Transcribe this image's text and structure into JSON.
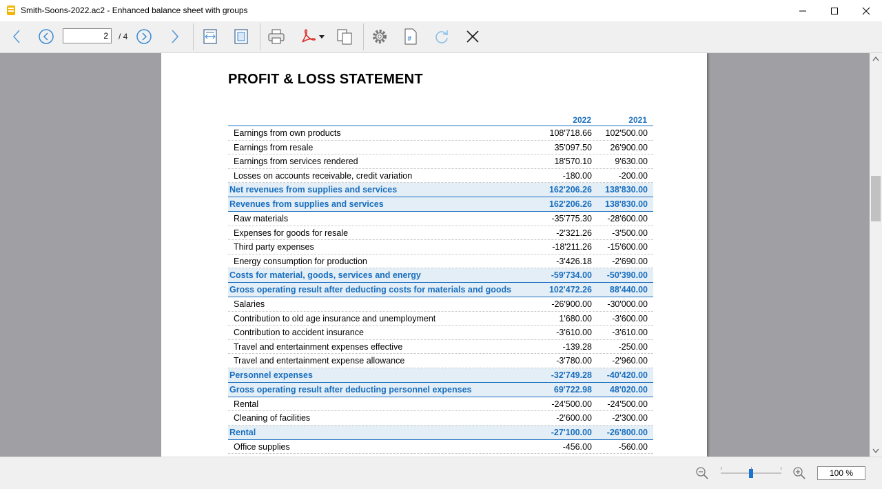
{
  "window": {
    "title": "Smith-Soons-2022.ac2 - Enhanced balance sheet with groups"
  },
  "toolbar": {
    "current_page": "2",
    "total_pages": "/ 4",
    "buttons": [
      "back-arrow-icon",
      "previous-page-icon",
      "next-page-icon",
      "forward-arrow-icon",
      "fit-width-icon",
      "fit-page-icon",
      "print-icon",
      "pdf-icon",
      "copy-icon",
      "settings-icon",
      "page-number-icon",
      "refresh-icon",
      "close-icon"
    ]
  },
  "report": {
    "title": "PROFIT & LOSS STATEMENT",
    "col1": "2022",
    "col2": "2021",
    "rows": [
      {
        "label": "Earnings from own products",
        "v1": "108'718.66",
        "v2": "102'500.00",
        "group": false
      },
      {
        "label": "Earnings from resale",
        "v1": "35'097.50",
        "v2": "26'900.00",
        "group": false
      },
      {
        "label": "Earnings from services rendered",
        "v1": "18'570.10",
        "v2": "9'630.00",
        "group": false
      },
      {
        "label": "Losses on accounts receivable, credit variation",
        "v1": "-180.00",
        "v2": "-200.00",
        "group": false
      },
      {
        "label": "Net revenues from supplies and services",
        "v1": "162'206.26",
        "v2": "138'830.00",
        "group": true
      },
      {
        "label": "Revenues from supplies and services",
        "v1": "162'206.26",
        "v2": "138'830.00",
        "group": true
      },
      {
        "label": "Raw materials",
        "v1": "-35'775.30",
        "v2": "-28'600.00",
        "group": false
      },
      {
        "label": "Expenses for goods for resale",
        "v1": "-2'321.26",
        "v2": "-3'500.00",
        "group": false
      },
      {
        "label": "Third party expenses",
        "v1": "-18'211.26",
        "v2": "-15'600.00",
        "group": false
      },
      {
        "label": "Energy consumption for production",
        "v1": "-3'426.18",
        "v2": "-2'690.00",
        "group": false
      },
      {
        "label": "Costs for material, goods, services and energy",
        "v1": "-59'734.00",
        "v2": "-50'390.00",
        "group": true
      },
      {
        "label": "Gross operating result after deducting costs for materials and goods",
        "v1": "102'472.26",
        "v2": "88'440.00",
        "group": true
      },
      {
        "label": "Salaries",
        "v1": "-26'900.00",
        "v2": "-30'000.00",
        "group": false
      },
      {
        "label": "Contribution to old age insurance and unemployment",
        "v1": "1'680.00",
        "v2": "-3'600.00",
        "group": false
      },
      {
        "label": "Contribution to accident insurance",
        "v1": "-3'610.00",
        "v2": "-3'610.00",
        "group": false
      },
      {
        "label": "Travel and entertainment expenses effective",
        "v1": "-139.28",
        "v2": "-250.00",
        "group": false
      },
      {
        "label": "Travel and entertainment expense allowance",
        "v1": "-3'780.00",
        "v2": "-2'960.00",
        "group": false
      },
      {
        "label": "Personnel expenses",
        "v1": "-32'749.28",
        "v2": "-40'420.00",
        "group": true
      },
      {
        "label": "Gross operating result after deducting personnel expenses",
        "v1": "69'722.98",
        "v2": "48'020.00",
        "group": true
      },
      {
        "label": "Rental",
        "v1": "-24'500.00",
        "v2": "-24'500.00",
        "group": false
      },
      {
        "label": "Cleaning of facilities",
        "v1": "-2'600.00",
        "v2": "-2'300.00",
        "group": false
      },
      {
        "label": "Rental",
        "v1": "-27'100.00",
        "v2": "-26'800.00",
        "group": true
      },
      {
        "label": "Office supplies",
        "v1": "-456.00",
        "v2": "-560.00",
        "group": false
      }
    ]
  },
  "statusbar": {
    "zoom": "100 %",
    "zoom_level": 0.5
  }
}
